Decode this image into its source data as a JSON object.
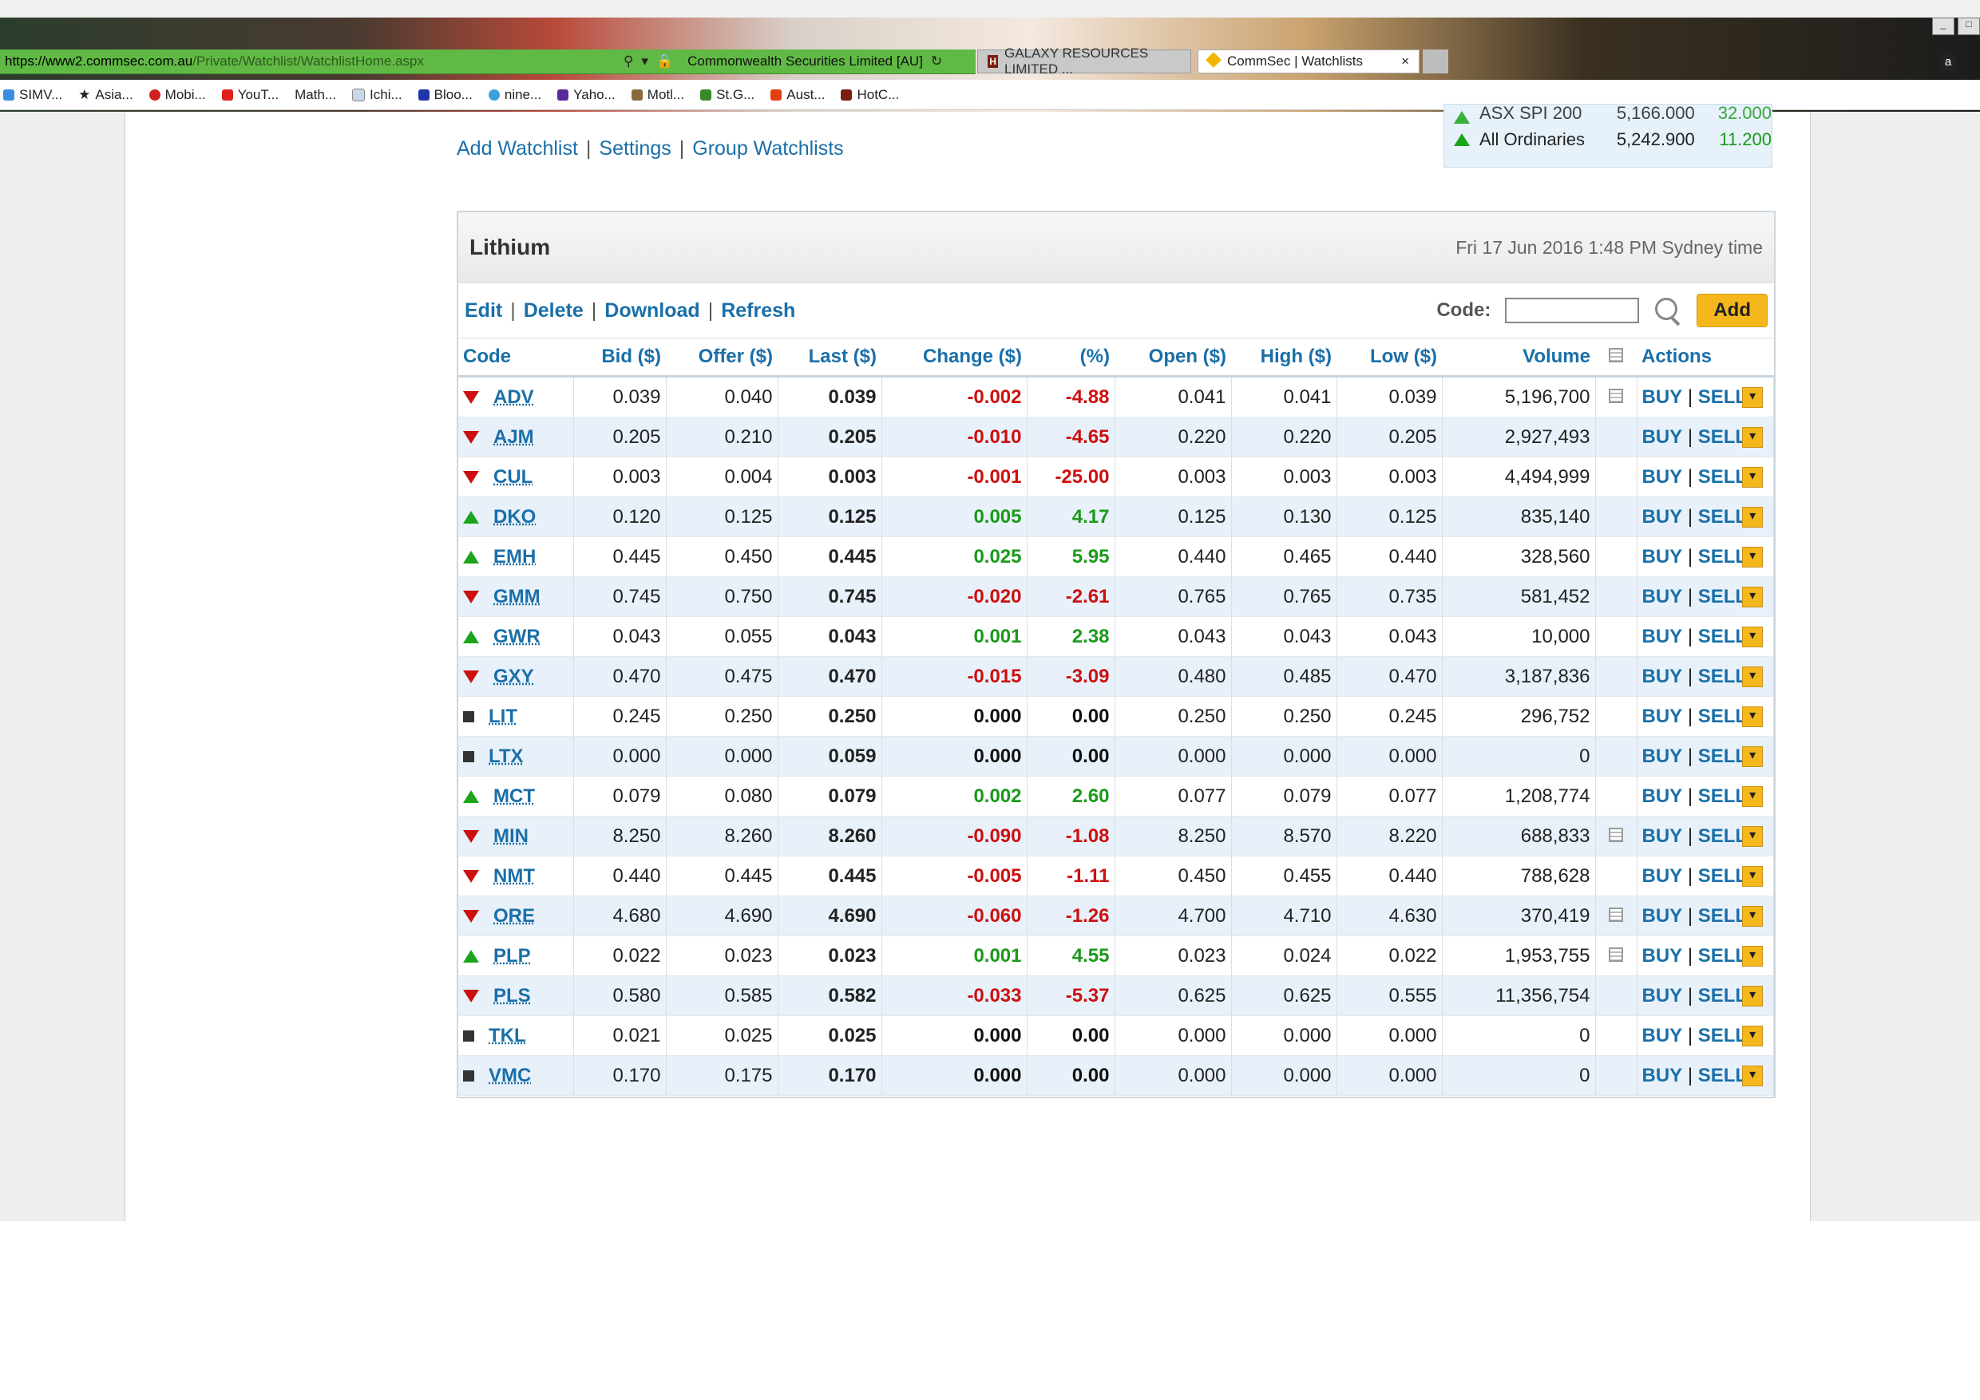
{
  "browser": {
    "url_host": "https://www2.commsec.com.au",
    "url_path": "/Private/Watchlist/WatchlistHome.aspx",
    "site_identity": "Commonwealth Securities Limited [AU]",
    "tabs": [
      {
        "label": "GALAXY RESOURCES LIMITED ...",
        "active": false
      },
      {
        "label": "CommSec | Watchlists",
        "active": true
      }
    ],
    "bookmarks": [
      "SIMV...",
      "Asia...",
      "Mobi...",
      "YouT...",
      "Math...",
      "Ichi...",
      "Bloo...",
      "nine...",
      "Yaho...",
      "Motl...",
      "St.G...",
      "Aust...",
      "HotC..."
    ]
  },
  "nav": {
    "add_watchlist": "Add Watchlist",
    "settings": "Settings",
    "group_watchlists": "Group Watchlists",
    "sep": "|"
  },
  "indices": [
    {
      "name": "ASX SPI 200",
      "value": "5,166.000",
      "change": "32.000",
      "dir": "up"
    },
    {
      "name": "All Ordinaries",
      "value": "5,242.900",
      "change": "11.200",
      "dir": "up"
    }
  ],
  "watchlist": {
    "title": "Lithium",
    "timestamp": "Fri 17 Jun 2016 1:48 PM Sydney time",
    "actions": [
      "Edit",
      "Delete",
      "Download",
      "Refresh"
    ],
    "code_label": "Code:",
    "add_label": "Add",
    "columns": [
      "Code",
      "Bid ($)",
      "Offer ($)",
      "Last ($)",
      "Change ($)",
      "(%)",
      "Open ($)",
      "High ($)",
      "Low ($)",
      "Volume",
      "",
      "Actions"
    ],
    "buy_label": "BUY",
    "sell_label": "SELL",
    "rows": [
      {
        "dir": "down",
        "code": "ADV",
        "bid": "0.039",
        "offer": "0.040",
        "last": "0.039",
        "change": "-0.002",
        "pct": "-4.88",
        "open": "0.041",
        "high": "0.041",
        "low": "0.039",
        "volume": "5,196,700",
        "chart": true
      },
      {
        "dir": "down",
        "code": "AJM",
        "bid": "0.205",
        "offer": "0.210",
        "last": "0.205",
        "change": "-0.010",
        "pct": "-4.65",
        "open": "0.220",
        "high": "0.220",
        "low": "0.205",
        "volume": "2,927,493",
        "chart": false
      },
      {
        "dir": "down",
        "code": "CUL",
        "bid": "0.003",
        "offer": "0.004",
        "last": "0.003",
        "change": "-0.001",
        "pct": "-25.00",
        "open": "0.003",
        "high": "0.003",
        "low": "0.003",
        "volume": "4,494,999",
        "chart": false
      },
      {
        "dir": "up",
        "code": "DKO",
        "bid": "0.120",
        "offer": "0.125",
        "last": "0.125",
        "change": "0.005",
        "pct": "4.17",
        "open": "0.125",
        "high": "0.130",
        "low": "0.125",
        "volume": "835,140",
        "chart": false
      },
      {
        "dir": "up",
        "code": "EMH",
        "bid": "0.445",
        "offer": "0.450",
        "last": "0.445",
        "change": "0.025",
        "pct": "5.95",
        "open": "0.440",
        "high": "0.465",
        "low": "0.440",
        "volume": "328,560",
        "chart": false
      },
      {
        "dir": "down",
        "code": "GMM",
        "bid": "0.745",
        "offer": "0.750",
        "last": "0.745",
        "change": "-0.020",
        "pct": "-2.61",
        "open": "0.765",
        "high": "0.765",
        "low": "0.735",
        "volume": "581,452",
        "chart": false
      },
      {
        "dir": "up",
        "code": "GWR",
        "bid": "0.043",
        "offer": "0.055",
        "last": "0.043",
        "change": "0.001",
        "pct": "2.38",
        "open": "0.043",
        "high": "0.043",
        "low": "0.043",
        "volume": "10,000",
        "chart": false
      },
      {
        "dir": "down",
        "code": "GXY",
        "bid": "0.470",
        "offer": "0.475",
        "last": "0.470",
        "change": "-0.015",
        "pct": "-3.09",
        "open": "0.480",
        "high": "0.485",
        "low": "0.470",
        "volume": "3,187,836",
        "chart": false
      },
      {
        "dir": "flat",
        "code": "LIT",
        "bid": "0.245",
        "offer": "0.250",
        "last": "0.250",
        "change": "0.000",
        "pct": "0.00",
        "open": "0.250",
        "high": "0.250",
        "low": "0.245",
        "volume": "296,752",
        "chart": false
      },
      {
        "dir": "flat",
        "code": "LTX",
        "bid": "0.000",
        "offer": "0.000",
        "last": "0.059",
        "change": "0.000",
        "pct": "0.00",
        "open": "0.000",
        "high": "0.000",
        "low": "0.000",
        "volume": "0",
        "chart": false
      },
      {
        "dir": "up",
        "code": "MCT",
        "bid": "0.079",
        "offer": "0.080",
        "last": "0.079",
        "change": "0.002",
        "pct": "2.60",
        "open": "0.077",
        "high": "0.079",
        "low": "0.077",
        "volume": "1,208,774",
        "chart": false
      },
      {
        "dir": "down",
        "code": "MIN",
        "bid": "8.250",
        "offer": "8.260",
        "last": "8.260",
        "change": "-0.090",
        "pct": "-1.08",
        "open": "8.250",
        "high": "8.570",
        "low": "8.220",
        "volume": "688,833",
        "chart": true
      },
      {
        "dir": "down",
        "code": "NMT",
        "bid": "0.440",
        "offer": "0.445",
        "last": "0.445",
        "change": "-0.005",
        "pct": "-1.11",
        "open": "0.450",
        "high": "0.455",
        "low": "0.440",
        "volume": "788,628",
        "chart": false
      },
      {
        "dir": "down",
        "code": "ORE",
        "bid": "4.680",
        "offer": "4.690",
        "last": "4.690",
        "change": "-0.060",
        "pct": "-1.26",
        "open": "4.700",
        "high": "4.710",
        "low": "4.630",
        "volume": "370,419",
        "chart": true
      },
      {
        "dir": "up",
        "code": "PLP",
        "bid": "0.022",
        "offer": "0.023",
        "last": "0.023",
        "change": "0.001",
        "pct": "4.55",
        "open": "0.023",
        "high": "0.024",
        "low": "0.022",
        "volume": "1,953,755",
        "chart": true
      },
      {
        "dir": "down",
        "code": "PLS",
        "bid": "0.580",
        "offer": "0.585",
        "last": "0.582",
        "change": "-0.033",
        "pct": "-5.37",
        "open": "0.625",
        "high": "0.625",
        "low": "0.555",
        "volume": "11,356,754",
        "chart": false
      },
      {
        "dir": "flat",
        "code": "TKL",
        "bid": "0.021",
        "offer": "0.025",
        "last": "0.025",
        "change": "0.000",
        "pct": "0.00",
        "open": "0.000",
        "high": "0.000",
        "low": "0.000",
        "volume": "0",
        "chart": false
      },
      {
        "dir": "flat",
        "code": "VMC",
        "bid": "0.170",
        "offer": "0.175",
        "last": "0.170",
        "change": "0.000",
        "pct": "0.00",
        "open": "0.000",
        "high": "0.000",
        "low": "0.000",
        "volume": "0",
        "chart": false
      }
    ]
  },
  "colors": {
    "link": "#1a6fa8",
    "negative": "#cc1010",
    "positive": "#1a9a1a",
    "row_alt": "#e8f1f9",
    "add_button": "#f5b81c"
  }
}
